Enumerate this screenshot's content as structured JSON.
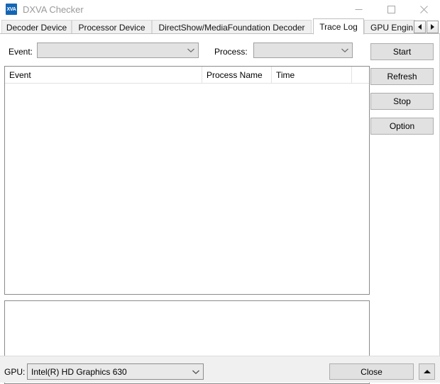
{
  "window": {
    "title": "DXVA Checker",
    "icon_label": "XVA",
    "controls": {
      "minimize": "minimize-icon",
      "maximize": "maximize-icon",
      "close": "close-icon"
    }
  },
  "tabs": {
    "items": [
      {
        "label": "Decoder Device",
        "selected": false
      },
      {
        "label": "Processor Device",
        "selected": false
      },
      {
        "label": "DirectShow/MediaFoundation Decoder",
        "selected": false
      },
      {
        "label": "Trace Log",
        "selected": true
      },
      {
        "label": "GPU Engin",
        "selected": false
      }
    ],
    "scroll_left": "◄",
    "scroll_right": "►"
  },
  "filters": {
    "event_label": "Event:",
    "event_value": "",
    "process_label": "Process:",
    "process_value": ""
  },
  "list": {
    "columns": [
      "Event",
      "Process Name",
      "Time",
      ""
    ],
    "rows": []
  },
  "log_panel": {
    "value": ""
  },
  "buttons": {
    "start": "Start",
    "refresh": "Refresh",
    "stop": "Stop",
    "option": "Option"
  },
  "statusbar": {
    "gpu_label": "GPU:",
    "gpu_value": "Intel(R) HD Graphics 630",
    "close": "Close",
    "expand": "expand-up-icon"
  },
  "colors": {
    "accent": "#1466b5",
    "window_bg": "#ffffff",
    "status_bg": "#f0f0f0",
    "button_face": "#e1e1e1",
    "disabled_combo": "#e2e2e2",
    "title_text": "#9a9a9a"
  }
}
